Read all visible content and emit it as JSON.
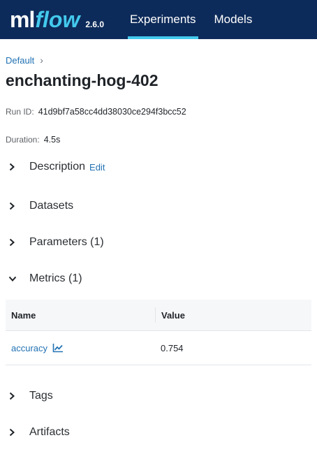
{
  "app": {
    "logo_ml": "ml",
    "logo_flow": "flow",
    "version": "2.6.0",
    "nav": [
      "Experiments",
      "Models"
    ],
    "active_nav": "Experiments"
  },
  "breadcrumb": {
    "experiment": "Default",
    "separator": "›"
  },
  "run": {
    "name": "enchanting-hog-402",
    "run_id_label": "Run ID:",
    "run_id": "41d9bf7a58cc4dd38030ce294f3bcc52",
    "duration_label": "Duration:",
    "duration": "4.5s"
  },
  "sections": {
    "description": {
      "label": "Description",
      "edit": "Edit"
    },
    "datasets": {
      "label": "Datasets"
    },
    "parameters": {
      "label": "Parameters (1)"
    },
    "metrics": {
      "label": "Metrics (1)"
    },
    "tags": {
      "label": "Tags"
    },
    "artifacts": {
      "label": "Artifacts"
    }
  },
  "metrics_table": {
    "headers": [
      "Name",
      "Value"
    ],
    "rows": [
      {
        "name": "accuracy",
        "value": "0.754",
        "icon": "line-chart-icon"
      }
    ]
  },
  "colors": {
    "header_bg": "#0d2b5a",
    "accent": "#43c9ed",
    "link": "#2272b4"
  }
}
